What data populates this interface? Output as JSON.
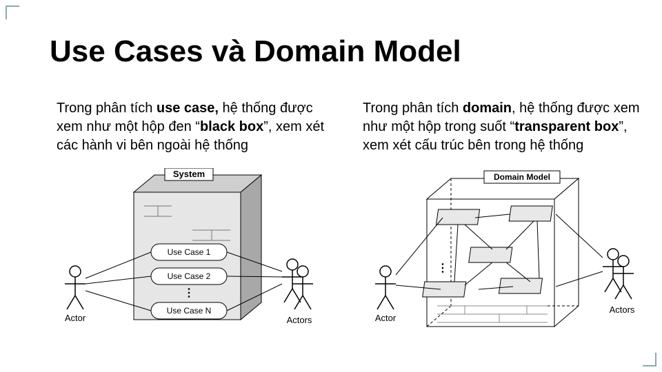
{
  "title": "Use Cases và Domain Model",
  "left_para_a": "Trong phân tích ",
  "left_para_b": "use case,",
  "left_para_c": " hệ thống được xem như một hộp đen  “",
  "left_para_d": "black box",
  "left_para_e": "”, xem xét các hành vi bên ngoài hệ thống",
  "right_para_a": "Trong phân tích ",
  "right_para_b": "domain",
  "right_para_c": ", hệ thống được xem như một hộp trong suốt “",
  "right_para_d": "transparent box",
  "right_para_e": "”, xem xét cấu trúc bên trong hệ thống",
  "dl": {
    "system": "System",
    "uc1": "Use Case 1",
    "uc2": "Use Case 2",
    "ucn": "Use Case N",
    "dots": "⋮",
    "actor": "Actor",
    "actors": "Actors"
  },
  "dr": {
    "dm": "Domain Model",
    "dots": "⋮",
    "actor": "Actor",
    "actors": "Actors"
  }
}
